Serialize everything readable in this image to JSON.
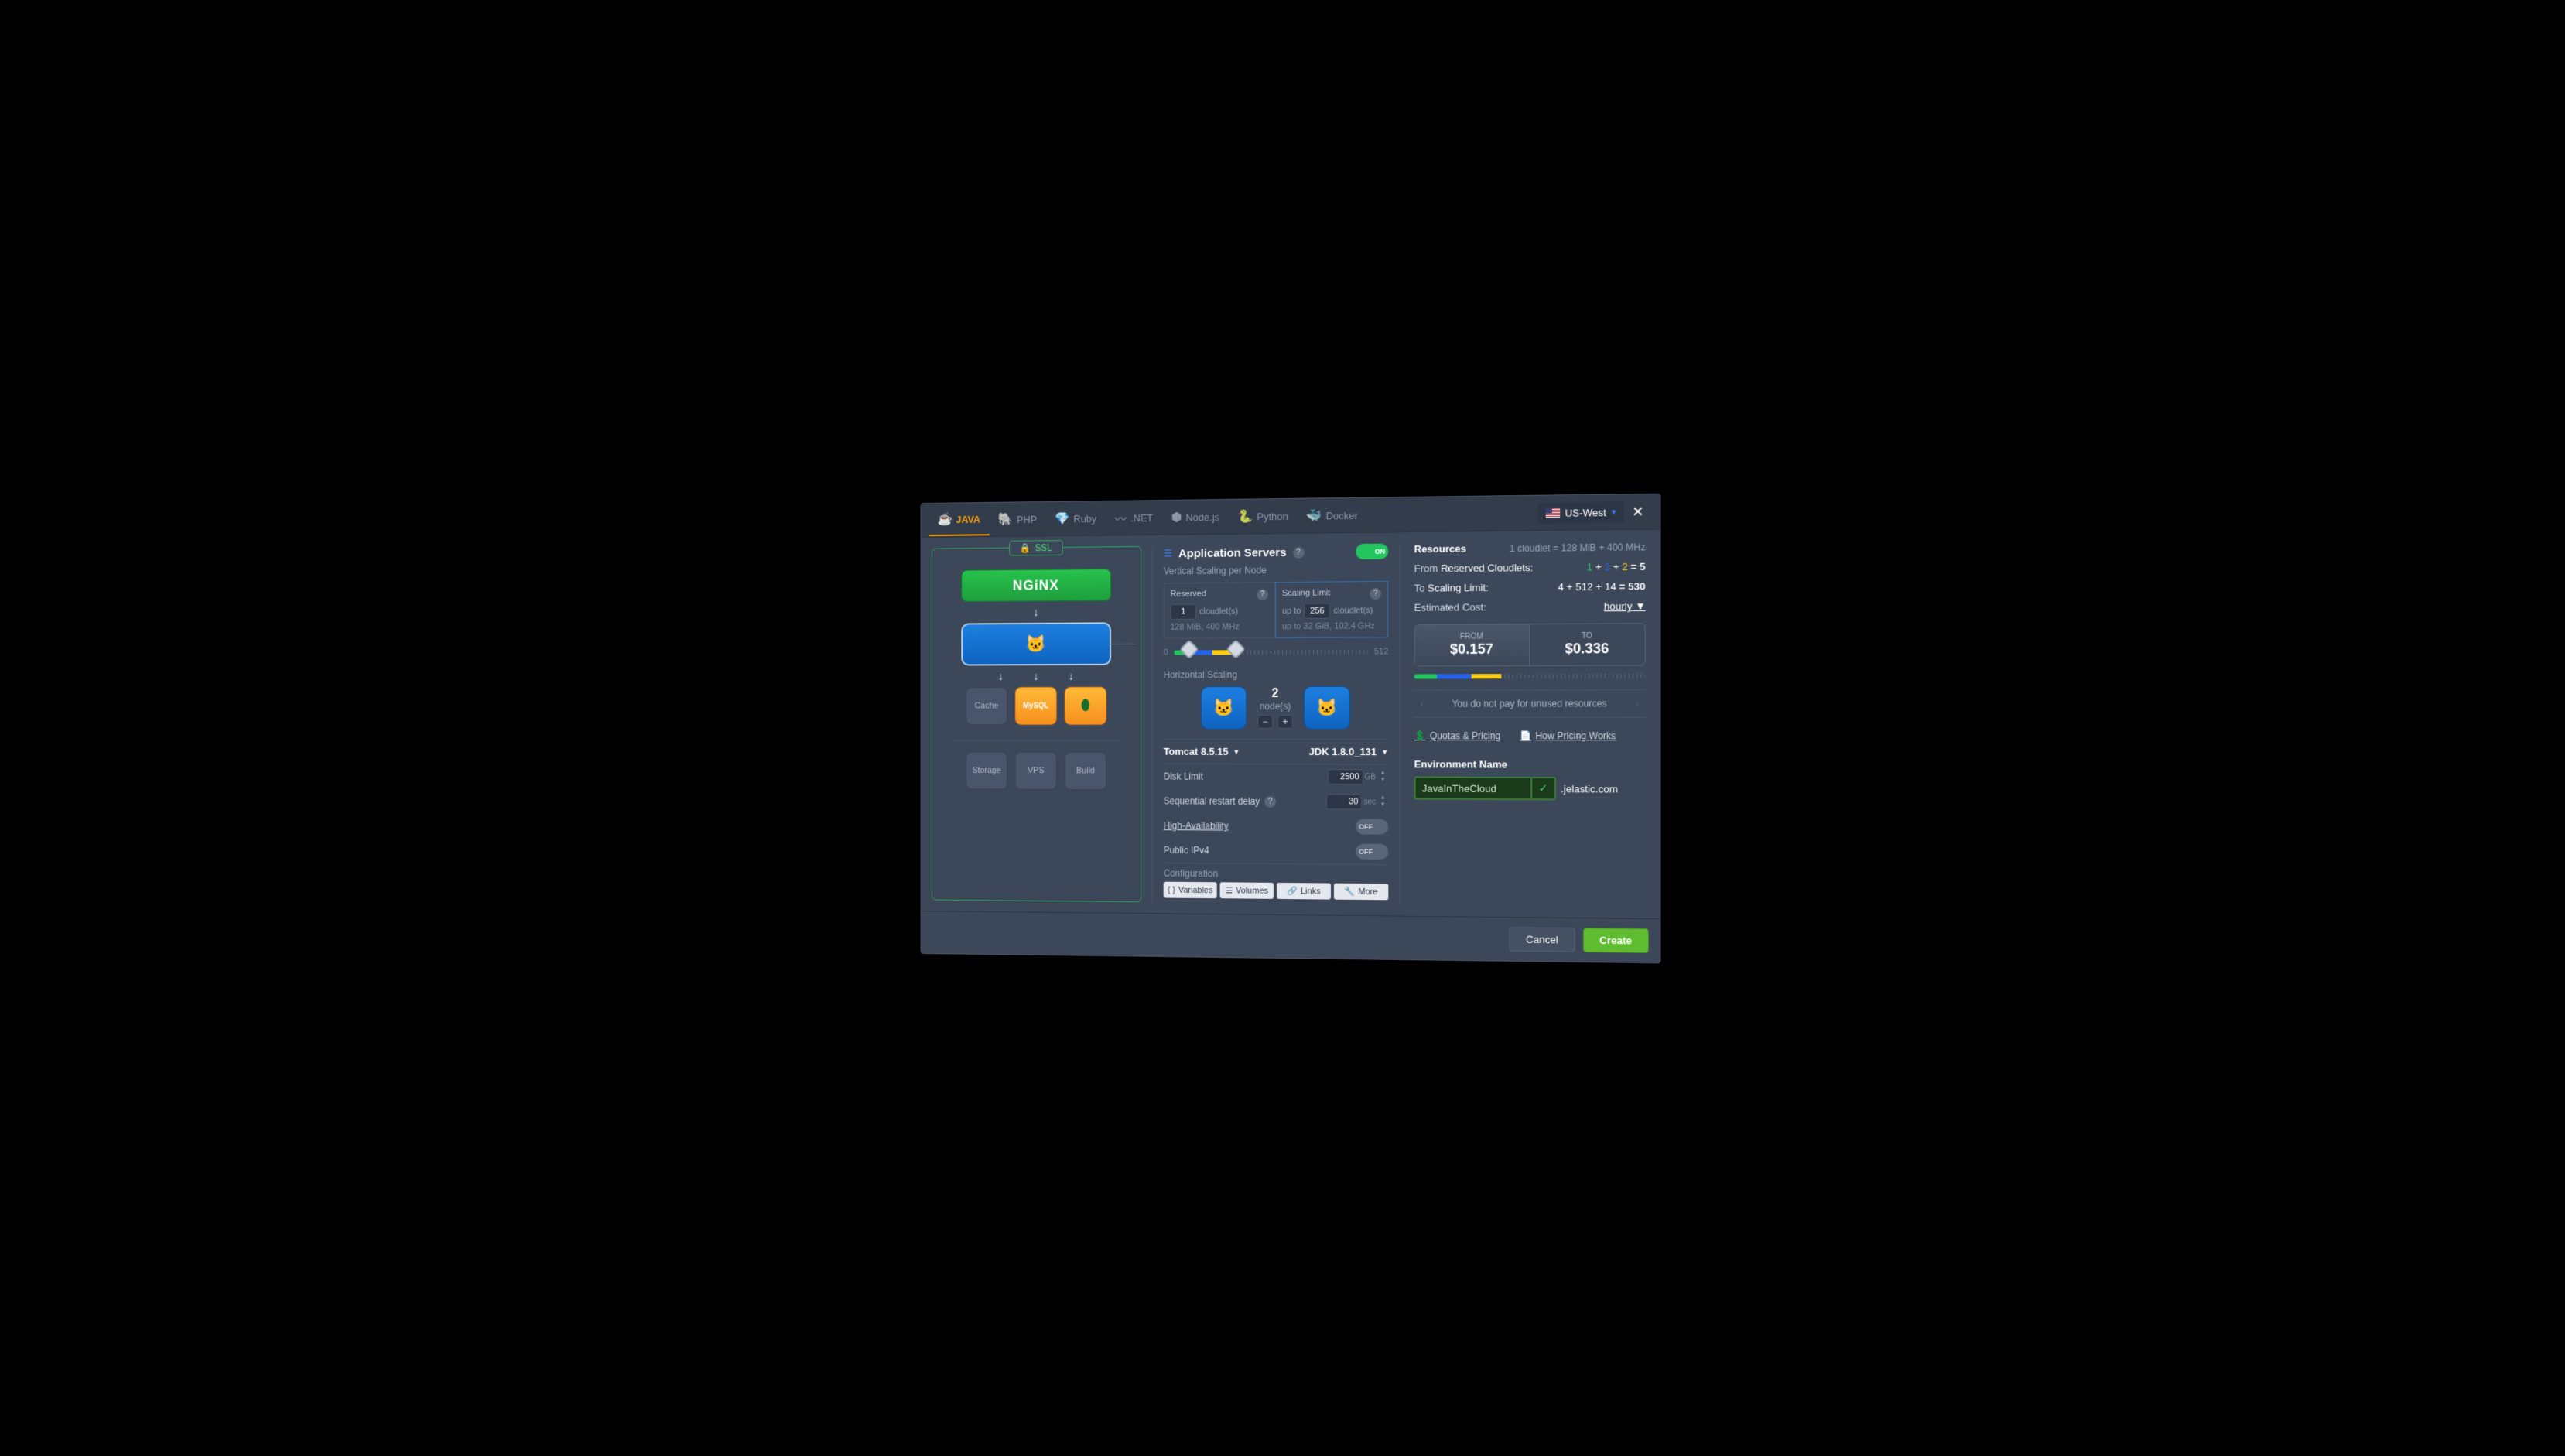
{
  "tabs": {
    "java": "JAVA",
    "php": "PHP",
    "ruby": "Ruby",
    "dotnet": ".NET",
    "nodejs": "Node.js",
    "python": "Python",
    "docker": "Docker"
  },
  "region": "US-West",
  "left": {
    "ssl": "SSL",
    "nginx": "NGiNX",
    "cache": "Cache",
    "storage": "Storage",
    "vps": "VPS",
    "build": "Build"
  },
  "mid": {
    "header": "Application Servers",
    "on": "ON",
    "vscale_title": "Vertical Scaling per Node",
    "reserved_lbl": "Reserved",
    "reserved_val": "1",
    "cloudlets": "cloudlet(s)",
    "reserved_spec": "128 MiB, 400 MHz",
    "limit_lbl": "Scaling Limit",
    "limit_upto": "up to",
    "limit_val": "256",
    "limit_spec": "32 GiB, 102.4 GHz",
    "slider_min": "0",
    "slider_max": "512",
    "hscale_title": "Horizontal Scaling",
    "nodes_count": "2",
    "nodes_lbl": "node(s)",
    "tomcat_ver": "Tomcat 8.5.15",
    "jdk_ver": "JDK 1.8.0_131",
    "disk_lbl": "Disk Limit",
    "disk_val": "2500",
    "disk_unit": "GB",
    "restart_lbl": "Sequential restart delay",
    "restart_val": "30",
    "restart_unit": "sec",
    "ha_lbl": "High-Availability",
    "ha_off": "OFF",
    "ipv4_lbl": "Public IPv4",
    "ipv4_off": "OFF",
    "config_lbl": "Configuration",
    "btn_vars": "Variables",
    "btn_vols": "Volumes",
    "btn_links": "Links",
    "btn_more": "More"
  },
  "right": {
    "resources": "Resources",
    "cloudlet_def": "1 cloudlet = 128 MiB + 400 MHz",
    "from_lbl": "From",
    "from_lbl2": "Reserved Cloudlets:",
    "from_expr": {
      "a": "1",
      "b": "2",
      "c": "2",
      "eq": "= 5"
    },
    "to_lbl": "To",
    "to_lbl2": "Scaling Limit:",
    "to_expr": {
      "a": "4",
      "b": "512",
      "c": "14",
      "eq": "= 530"
    },
    "cost_lbl": "Estimated Cost:",
    "cost_period": "hourly",
    "cost_from_lbl": "FROM",
    "cost_from": "$0.157",
    "cost_to_lbl": "TO",
    "cost_to": "$0.336",
    "carousel": "You do not pay for unused resources",
    "quotas": "Quotas & Pricing",
    "how": "How Pricing Works",
    "env_title": "Environment Name",
    "env_val": "JavaInTheCloud",
    "env_domain": ".jelastic.com"
  },
  "footer": {
    "cancel": "Cancel",
    "create": "Create"
  }
}
